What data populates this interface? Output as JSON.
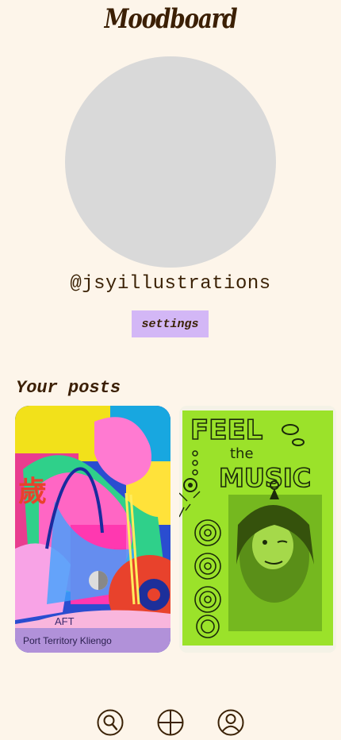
{
  "app": {
    "title": "Moodboard"
  },
  "profile": {
    "username": "@jsyillustrations",
    "avatar_color": "#d9d9d9"
  },
  "settings": {
    "label": "settings",
    "color": "#d3b7f6"
  },
  "posts": {
    "heading": "Your posts",
    "items": [
      {
        "art_glyph": "歲",
        "art_text_1": "AFT",
        "art_text_2": "Port Territory Kliengo"
      },
      {
        "art_text_1": "FEEL",
        "art_text_2": "the",
        "art_text_3": "MUSIC"
      }
    ]
  },
  "nav": {
    "icons": [
      "search-icon",
      "add-icon",
      "profile-icon"
    ]
  },
  "colors": {
    "background": "#fdf5ea",
    "text": "#3b2206"
  }
}
